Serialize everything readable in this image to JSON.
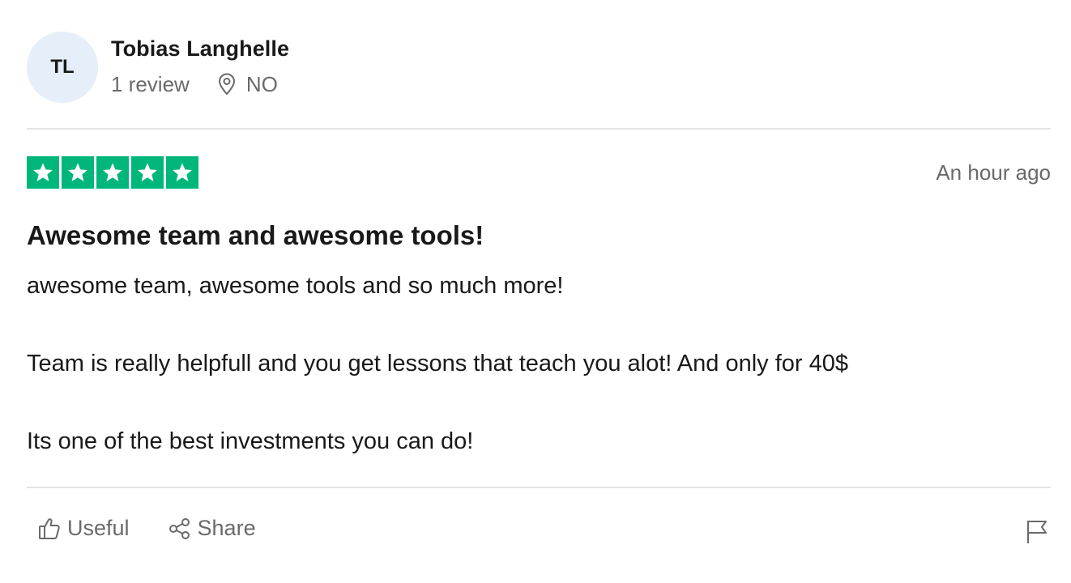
{
  "reviewer": {
    "initials": "TL",
    "name": "Tobias Langhelle",
    "review_count": "1 review",
    "country": "NO",
    "location_icon": "location-pin-icon"
  },
  "review": {
    "rating": 5,
    "star_color": "#00b67a",
    "date": "An hour ago",
    "title": "Awesome team and awesome tools!",
    "paragraphs": [
      "awesome team, awesome tools and so much more!",
      "Team is really helpfull and you get lessons that teach you alot! And only for 40$",
      "Its one of the best investments you can do!"
    ]
  },
  "actions": {
    "useful_label": "Useful",
    "useful_icon": "thumbs-up-icon",
    "share_label": "Share",
    "share_icon": "share-icon",
    "report_icon": "flag-icon"
  },
  "colors": {
    "avatar_bg": "#e5eef9",
    "muted_text": "#696a6a",
    "divider": "#e3e3e6"
  }
}
